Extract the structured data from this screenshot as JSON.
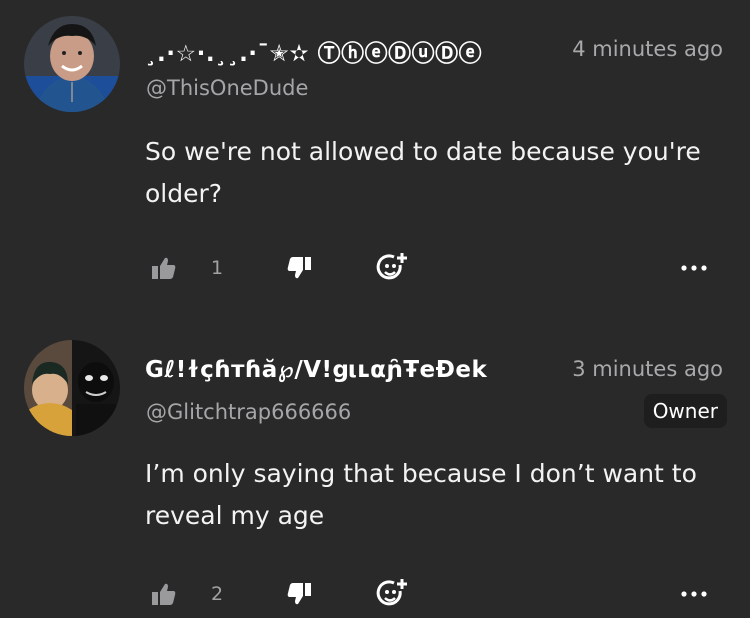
{
  "comments": [
    {
      "author_name": "¸.·☆·.¸¸.·¯✭✫ ⓉⓗⓔⒹⓤⒹⓔ",
      "handle": "@ThisOneDude",
      "time": "4 minutes ago",
      "text": "So we're not allowed to date because you're older?",
      "likes": "1",
      "badge": ""
    },
    {
      "author_name": "Gℓ!ɫçɦтɦă℘/V!ցιʟαɲ̑ŦeĐek",
      "handle": "@Glitchtrap666666",
      "time": "3 minutes ago",
      "text": "I’m only saying that because I don’t want to reveal my age",
      "likes": "2",
      "badge": "Owner"
    }
  ],
  "icons": {
    "like": "thumbs-up-icon",
    "dislike": "thumbs-down-icon",
    "reply": "reply-emoji-icon",
    "more": "more-dots-icon"
  },
  "colors": {
    "background": "#29292a",
    "text": "#ffffff",
    "muted": "#a9a9ab",
    "badge_bg": "#1e1e1f"
  }
}
